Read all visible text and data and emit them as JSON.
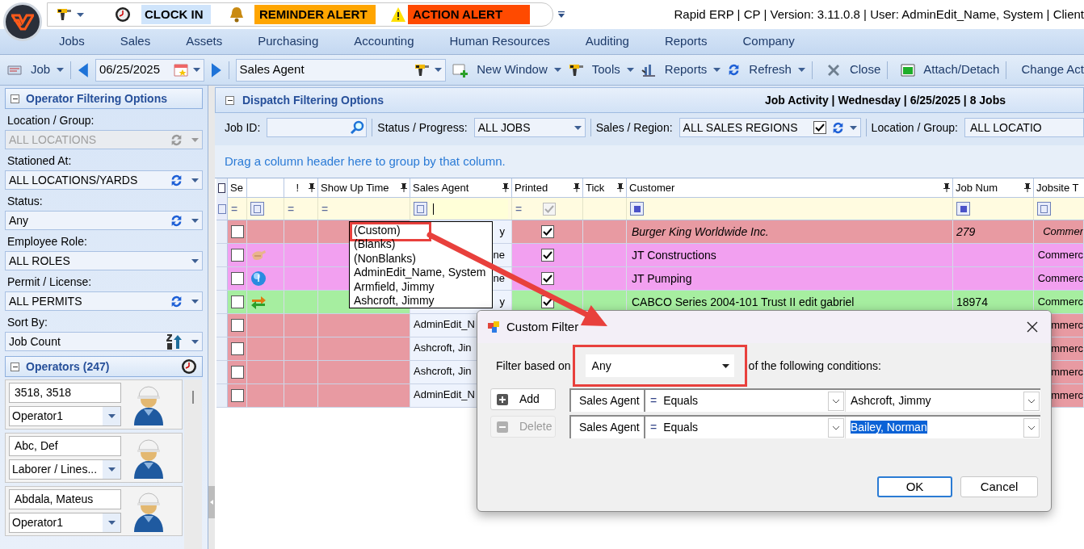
{
  "quick_access": {
    "clock_in": "CLOCK IN",
    "reminder": "REMINDER ALERT",
    "action": "ACTION ALERT"
  },
  "title": "Rapid ERP | CP | Version: 3.11.0.8 | User: AdminEdit_Name, System | Client",
  "menu": [
    "Jobs",
    "Sales",
    "Assets",
    "Purchasing",
    "Accounting",
    "Human Resources",
    "Auditing",
    "Reports",
    "Company"
  ],
  "toolbar": {
    "job": "Job",
    "date": "06/25/2025",
    "view": "Sales Agent",
    "items": [
      {
        "label": "New Window",
        "kind": "new-window",
        "dropdown": true
      },
      {
        "label": "Tools",
        "kind": "tools",
        "dropdown": true
      },
      {
        "label": "Reports",
        "kind": "reports",
        "dropdown": true
      },
      {
        "label": "Refresh",
        "kind": "refresh",
        "dropdown": true
      },
      {
        "label": "Close",
        "kind": "close",
        "dropdown": false
      },
      {
        "label": "Attach/Detach",
        "kind": "attach",
        "dropdown": false
      },
      {
        "label": "Change Act",
        "kind": "text",
        "dropdown": false
      }
    ]
  },
  "operator_filters": {
    "title": "Operator Filtering Options",
    "expanded": true,
    "fields": [
      {
        "label": "Location / Group:",
        "value": "ALL LOCATIONS",
        "kind": "refresh",
        "disabled": true
      },
      {
        "label": "Stationed At:",
        "value": "ALL LOCATIONS/YARDS",
        "kind": "refresh",
        "disabled": false
      },
      {
        "label": "Status:",
        "value": "Any",
        "kind": "refresh",
        "disabled": false
      },
      {
        "label": "Employee Role:",
        "value": "ALL ROLES",
        "kind": "plain",
        "disabled": false
      },
      {
        "label": "Permit / License:",
        "value": "ALL PERMITS",
        "kind": "refresh",
        "disabled": false
      },
      {
        "label": "Sort By:",
        "value": "Job Count",
        "kind": "sort",
        "disabled": false
      }
    ]
  },
  "operators": {
    "title": "Operators (247)",
    "expanded": true,
    "items": [
      {
        "name": "3518, 3518",
        "role": "Operator1"
      },
      {
        "name": "Abc, Def",
        "role": "Laborer / Lines..."
      },
      {
        "name": "Abdala, Mateus",
        "role": "Operator1"
      }
    ]
  },
  "dispatch": {
    "title": "Dispatch Filtering Options",
    "expanded": true,
    "summary": "Job Activity | Wednesday | 6/25/2025 | 8 Jobs",
    "filters": [
      {
        "label": "Job ID:",
        "kind": "search"
      },
      {
        "label": "Status / Progress:",
        "kind": "combo",
        "value": "ALL JOBS"
      },
      {
        "label": "Sales / Region:",
        "kind": "combo-check",
        "value": "ALL SALES REGIONS",
        "checked": true
      },
      {
        "label": "Location / Group:",
        "kind": "cut",
        "value": "ALL LOCATIO"
      }
    ]
  },
  "group_hint": "Drag a column header here to group by that column.",
  "grid": {
    "columns": [
      {
        "header": "Se",
        "pinned": false,
        "filter": {
          "kind": "op",
          "text": "="
        }
      },
      {
        "pinned": false,
        "filter": {
          "kind": "text-icon"
        }
      },
      {
        "header": "!",
        "pinned": true,
        "filter": {
          "kind": "op",
          "text": "="
        }
      },
      {
        "header": "Show Up Time",
        "pinned": true,
        "filter": {
          "kind": "op",
          "text": "="
        }
      },
      {
        "header": "Sales Agent",
        "pinned": true,
        "filter": {
          "kind": "input"
        }
      },
      {
        "header": "Printed",
        "pinned": true,
        "filter": {
          "kind": "check-op",
          "text": "=",
          "checked": true
        }
      },
      {
        "header": "Tick",
        "pinned": true,
        "filter": {
          "kind": "none"
        }
      },
      {
        "header": "Customer",
        "pinned": true,
        "filter": {
          "kind": "square-icon"
        }
      },
      {
        "header": "Job Num",
        "pinned": true,
        "filter": {
          "kind": "square-icon"
        }
      },
      {
        "header": "Jobsite T",
        "pinned": false,
        "filter": {
          "kind": "text-icon"
        }
      }
    ],
    "rows": [
      {
        "color": "#e89aa2",
        "checked": false,
        "kind": "plain",
        "sales_agent": "y",
        "printed": true,
        "customer": "Burger King Worldwide Inc.",
        "job_num": "279",
        "jobsite": "Commer",
        "italic": true
      },
      {
        "color": "#f2a0f0",
        "checked": false,
        "kind": "hand",
        "sales_agent": "ne",
        "printed": true,
        "customer": "JT Constructions",
        "jobsite": "Commerc",
        "italic": false
      },
      {
        "color": "#f2a0f0",
        "checked": false,
        "kind": "info",
        "sales_agent": "ne",
        "printed": true,
        "customer": "JT Pumping",
        "jobsite": "Commerc",
        "italic": false
      },
      {
        "color": "#a6eea0",
        "checked": false,
        "kind": "swap",
        "sales_agent": "y",
        "printed": true,
        "customer": "CABCO Series 2004-101 Trust II edit gabriel",
        "job_num": "18974",
        "jobsite": "Commerc",
        "italic": false
      },
      {
        "color": "#e89aa2",
        "checked": false,
        "kind": "plain",
        "sales_agent": "AdminEdit_N",
        "jobsite": "mmerc"
      },
      {
        "color": "#e89aa2",
        "checked": false,
        "kind": "plain",
        "sales_agent": "Ashcroft, Jin",
        "jobsite": "mmerc"
      },
      {
        "color": "#e89aa2",
        "checked": false,
        "kind": "plain",
        "sales_agent": "Ashcroft, Jin",
        "jobsite": "mmerc"
      },
      {
        "color": "#e89aa2",
        "checked": false,
        "kind": "plain",
        "sales_agent": "AdminEdit_N",
        "jobsite": "mmerc"
      }
    ]
  },
  "agent_dropdown": {
    "items": [
      {
        "label": "(Custom)",
        "highlighted": true
      },
      {
        "label": "(Blanks)",
        "highlighted": false
      },
      {
        "label": "(NonBlanks)",
        "highlighted": false
      },
      {
        "label": "AdminEdit_Name, System",
        "highlighted": false
      },
      {
        "label": "Armfield, Jimmy",
        "highlighted": false
      },
      {
        "label": "Ashcroft, Jimmy",
        "highlighted": false
      }
    ]
  },
  "dialog": {
    "title": "Custom Filter",
    "prefix": "Filter based on",
    "mode": "Any",
    "mode_highlighted": true,
    "suffix": "of the following conditions:",
    "add": {
      "label": "Add",
      "disabled": false
    },
    "delete": {
      "label": "Delete",
      "disabled": true
    },
    "conditions": [
      {
        "field": "Sales Agent",
        "sign": "=",
        "operator": "Equals",
        "value": "Ashcroft, Jimmy",
        "selected": false
      },
      {
        "field": "Sales Agent",
        "sign": "=",
        "operator": "Equals",
        "value": "Bailey, Norman",
        "selected": true
      }
    ],
    "ok": "OK",
    "cancel": "Cancel"
  }
}
